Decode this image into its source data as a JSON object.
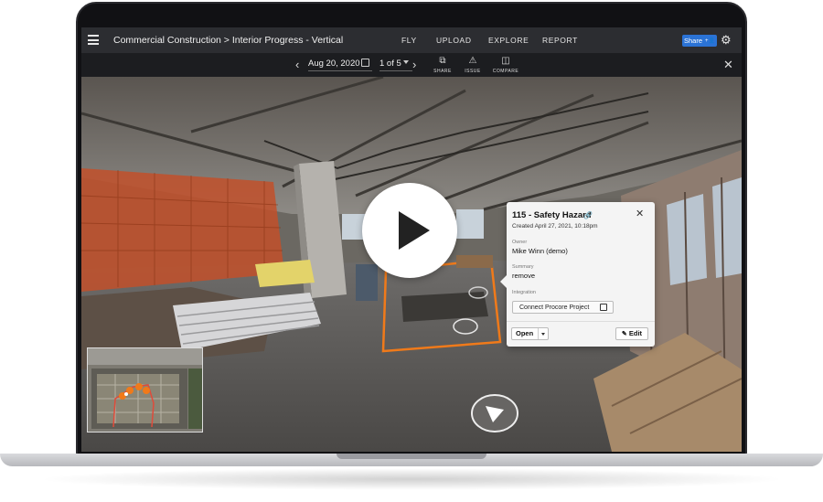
{
  "header": {
    "breadcrumb": "Commercial Construction > Interior Progress - Vertical",
    "nav": [
      "FLY",
      "UPLOAD",
      "EXPLORE",
      "REPORT"
    ],
    "share_label": "Share",
    "menu_icon": "hamburger-icon",
    "settings_icon": "gear-icon"
  },
  "toolbar": {
    "date": "Aug 20, 2020",
    "pager": "1 of 5",
    "tools": [
      {
        "label": "SHARE",
        "icon": "share-icon"
      },
      {
        "label": "ISSUE",
        "icon": "warning-icon"
      },
      {
        "label": "COMPARE",
        "icon": "compare-icon"
      }
    ]
  },
  "issue_card": {
    "title": "115 - Safety Hazard",
    "created": "Created April 27, 2021, 10:18pm",
    "owner_label": "Owner",
    "owner": "Mike Winn (demo)",
    "summary_label": "Summary",
    "summary": "remove",
    "integration_label": "Integration",
    "connect_label": "Connect Procore Project",
    "open_label": "Open",
    "edit_label": "Edit"
  },
  "colors": {
    "accent_blue": "#2b73d6",
    "highlight_orange": "#f07a1a",
    "topbar": "#2c2d31"
  }
}
